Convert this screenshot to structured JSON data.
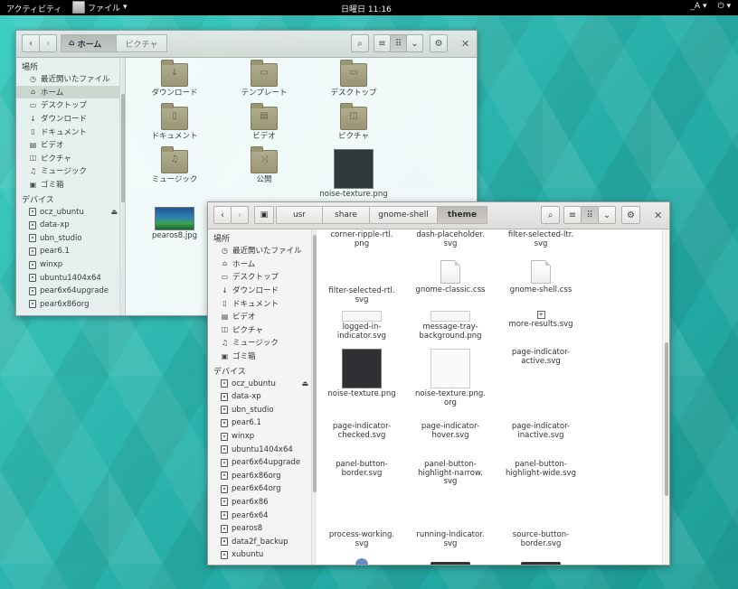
{
  "topbar": {
    "activities": "アクティビティ",
    "app_menu": "ファイル",
    "clock": "日曜日 11:16",
    "input_method": "_A",
    "power": "⏻"
  },
  "window1": {
    "crumbs": [
      "ホーム",
      "ピクチャ"
    ],
    "sidebar": {
      "places_heading": "場所",
      "places": [
        {
          "icon": "recent-icon",
          "glyph": "◷",
          "label": "最近開いたファイル"
        },
        {
          "icon": "home-icon",
          "glyph": "⌂",
          "label": "ホーム",
          "selected": true
        },
        {
          "icon": "desktop-icon",
          "glyph": "▭",
          "label": "デスクトップ"
        },
        {
          "icon": "download-icon",
          "glyph": "↓",
          "label": "ダウンロード"
        },
        {
          "icon": "document-icon",
          "glyph": "▯",
          "label": "ドキュメント"
        },
        {
          "icon": "video-icon",
          "glyph": "▤",
          "label": "ビデオ"
        },
        {
          "icon": "picture-icon",
          "glyph": "◫",
          "label": "ピクチャ"
        },
        {
          "icon": "music-icon",
          "glyph": "♫",
          "label": "ミュージック"
        },
        {
          "icon": "trash-icon",
          "glyph": "▣",
          "label": "ゴミ箱"
        }
      ],
      "devices_heading": "デバイス",
      "devices": [
        "ocz_ubuntu",
        "data-xp",
        "ubn_studio",
        "pear6.1",
        "winxp",
        "ubuntu1404x64",
        "pear6x64upgrade",
        "pear6x86org"
      ]
    },
    "files": [
      {
        "name": "ダウンロード",
        "kind": "folder",
        "glyph": "↓"
      },
      {
        "name": "テンプレート",
        "kind": "folder",
        "glyph": "▭"
      },
      {
        "name": "デスクトップ",
        "kind": "folder",
        "glyph": "▭"
      },
      {
        "name": "ドキュメント",
        "kind": "folder",
        "glyph": "▯"
      },
      {
        "name": "ビデオ",
        "kind": "folder",
        "glyph": "▤"
      },
      {
        "name": "ピクチャ",
        "kind": "folder",
        "glyph": "◫"
      },
      {
        "name": "ミュージック",
        "kind": "folder",
        "glyph": "♫"
      },
      {
        "name": "公開",
        "kind": "folder",
        "glyph": "⤨"
      },
      {
        "name": "noise-texture.png",
        "kind": "dark"
      },
      {
        "name": "pearos8.jpg",
        "kind": "image"
      }
    ]
  },
  "window2": {
    "crumbs": [
      "usr",
      "share",
      "gnome-shell",
      "theme"
    ],
    "sidebar": {
      "places_heading": "場所",
      "places": [
        {
          "icon": "recent-icon",
          "glyph": "◷",
          "label": "最近開いたファイル"
        },
        {
          "icon": "home-icon",
          "glyph": "⌂",
          "label": "ホーム"
        },
        {
          "icon": "desktop-icon",
          "glyph": "▭",
          "label": "デスクトップ"
        },
        {
          "icon": "download-icon",
          "glyph": "↓",
          "label": "ダウンロード"
        },
        {
          "icon": "document-icon",
          "glyph": "▯",
          "label": "ドキュメント"
        },
        {
          "icon": "video-icon",
          "glyph": "▤",
          "label": "ビデオ"
        },
        {
          "icon": "picture-icon",
          "glyph": "◫",
          "label": "ピクチャ"
        },
        {
          "icon": "music-icon",
          "glyph": "♫",
          "label": "ミュージック"
        },
        {
          "icon": "trash-icon",
          "glyph": "▣",
          "label": "ゴミ箱"
        }
      ],
      "devices_heading": "デバイス",
      "devices": [
        "ocz_ubuntu",
        "data-xp",
        "ubn_studio",
        "pear6.1",
        "winxp",
        "ubuntu1404x64",
        "pear6x64upgrade",
        "pear6x86org",
        "pear6x64org",
        "pear6x86",
        "pear6x64",
        "pearos8",
        "data2f_backup",
        "xubuntu"
      ]
    },
    "files": [
      {
        "name": "corner-ripple-rtl.\npng",
        "kind": "none"
      },
      {
        "name": "dash-placeholder.\nsvg",
        "kind": "none"
      },
      {
        "name": "filter-selected-ltr.\nsvg",
        "kind": "none"
      },
      {
        "name": "filter-selected-rtl.\nsvg",
        "kind": "doc-hidden"
      },
      {
        "name": "gnome-classic.css",
        "kind": "doc"
      },
      {
        "name": "gnome-shell.css",
        "kind": "doc"
      },
      {
        "name": "logged-in-\nindicator.svg",
        "kind": "strip"
      },
      {
        "name": "message-tray-\nbackground.png",
        "kind": "strip"
      },
      {
        "name": "more-results.svg",
        "kind": "tiny"
      },
      {
        "name": "noise-texture.png",
        "kind": "dark"
      },
      {
        "name": "noise-texture.png.\norg",
        "kind": "light"
      },
      {
        "name": "page-indicator-\nactive.svg",
        "kind": "none"
      },
      {
        "name": "page-indicator-\nchecked.svg",
        "kind": "none"
      },
      {
        "name": "page-indicator-\nhover.svg",
        "kind": "none"
      },
      {
        "name": "page-indicator-\ninactive.svg",
        "kind": "none"
      },
      {
        "name": "panel-button-\nborder.svg",
        "kind": "none"
      },
      {
        "name": "panel-button-\nhighlight-narrow.\nsvg",
        "kind": "none"
      },
      {
        "name": "panel-button-\nhighlight-wide.svg",
        "kind": "none"
      },
      {
        "name": "process-working.\nsvg",
        "kind": "none"
      },
      {
        "name": "running-indicator.\nsvg",
        "kind": "none"
      },
      {
        "name": "source-button-\nborder.svg",
        "kind": "none"
      }
    ]
  }
}
